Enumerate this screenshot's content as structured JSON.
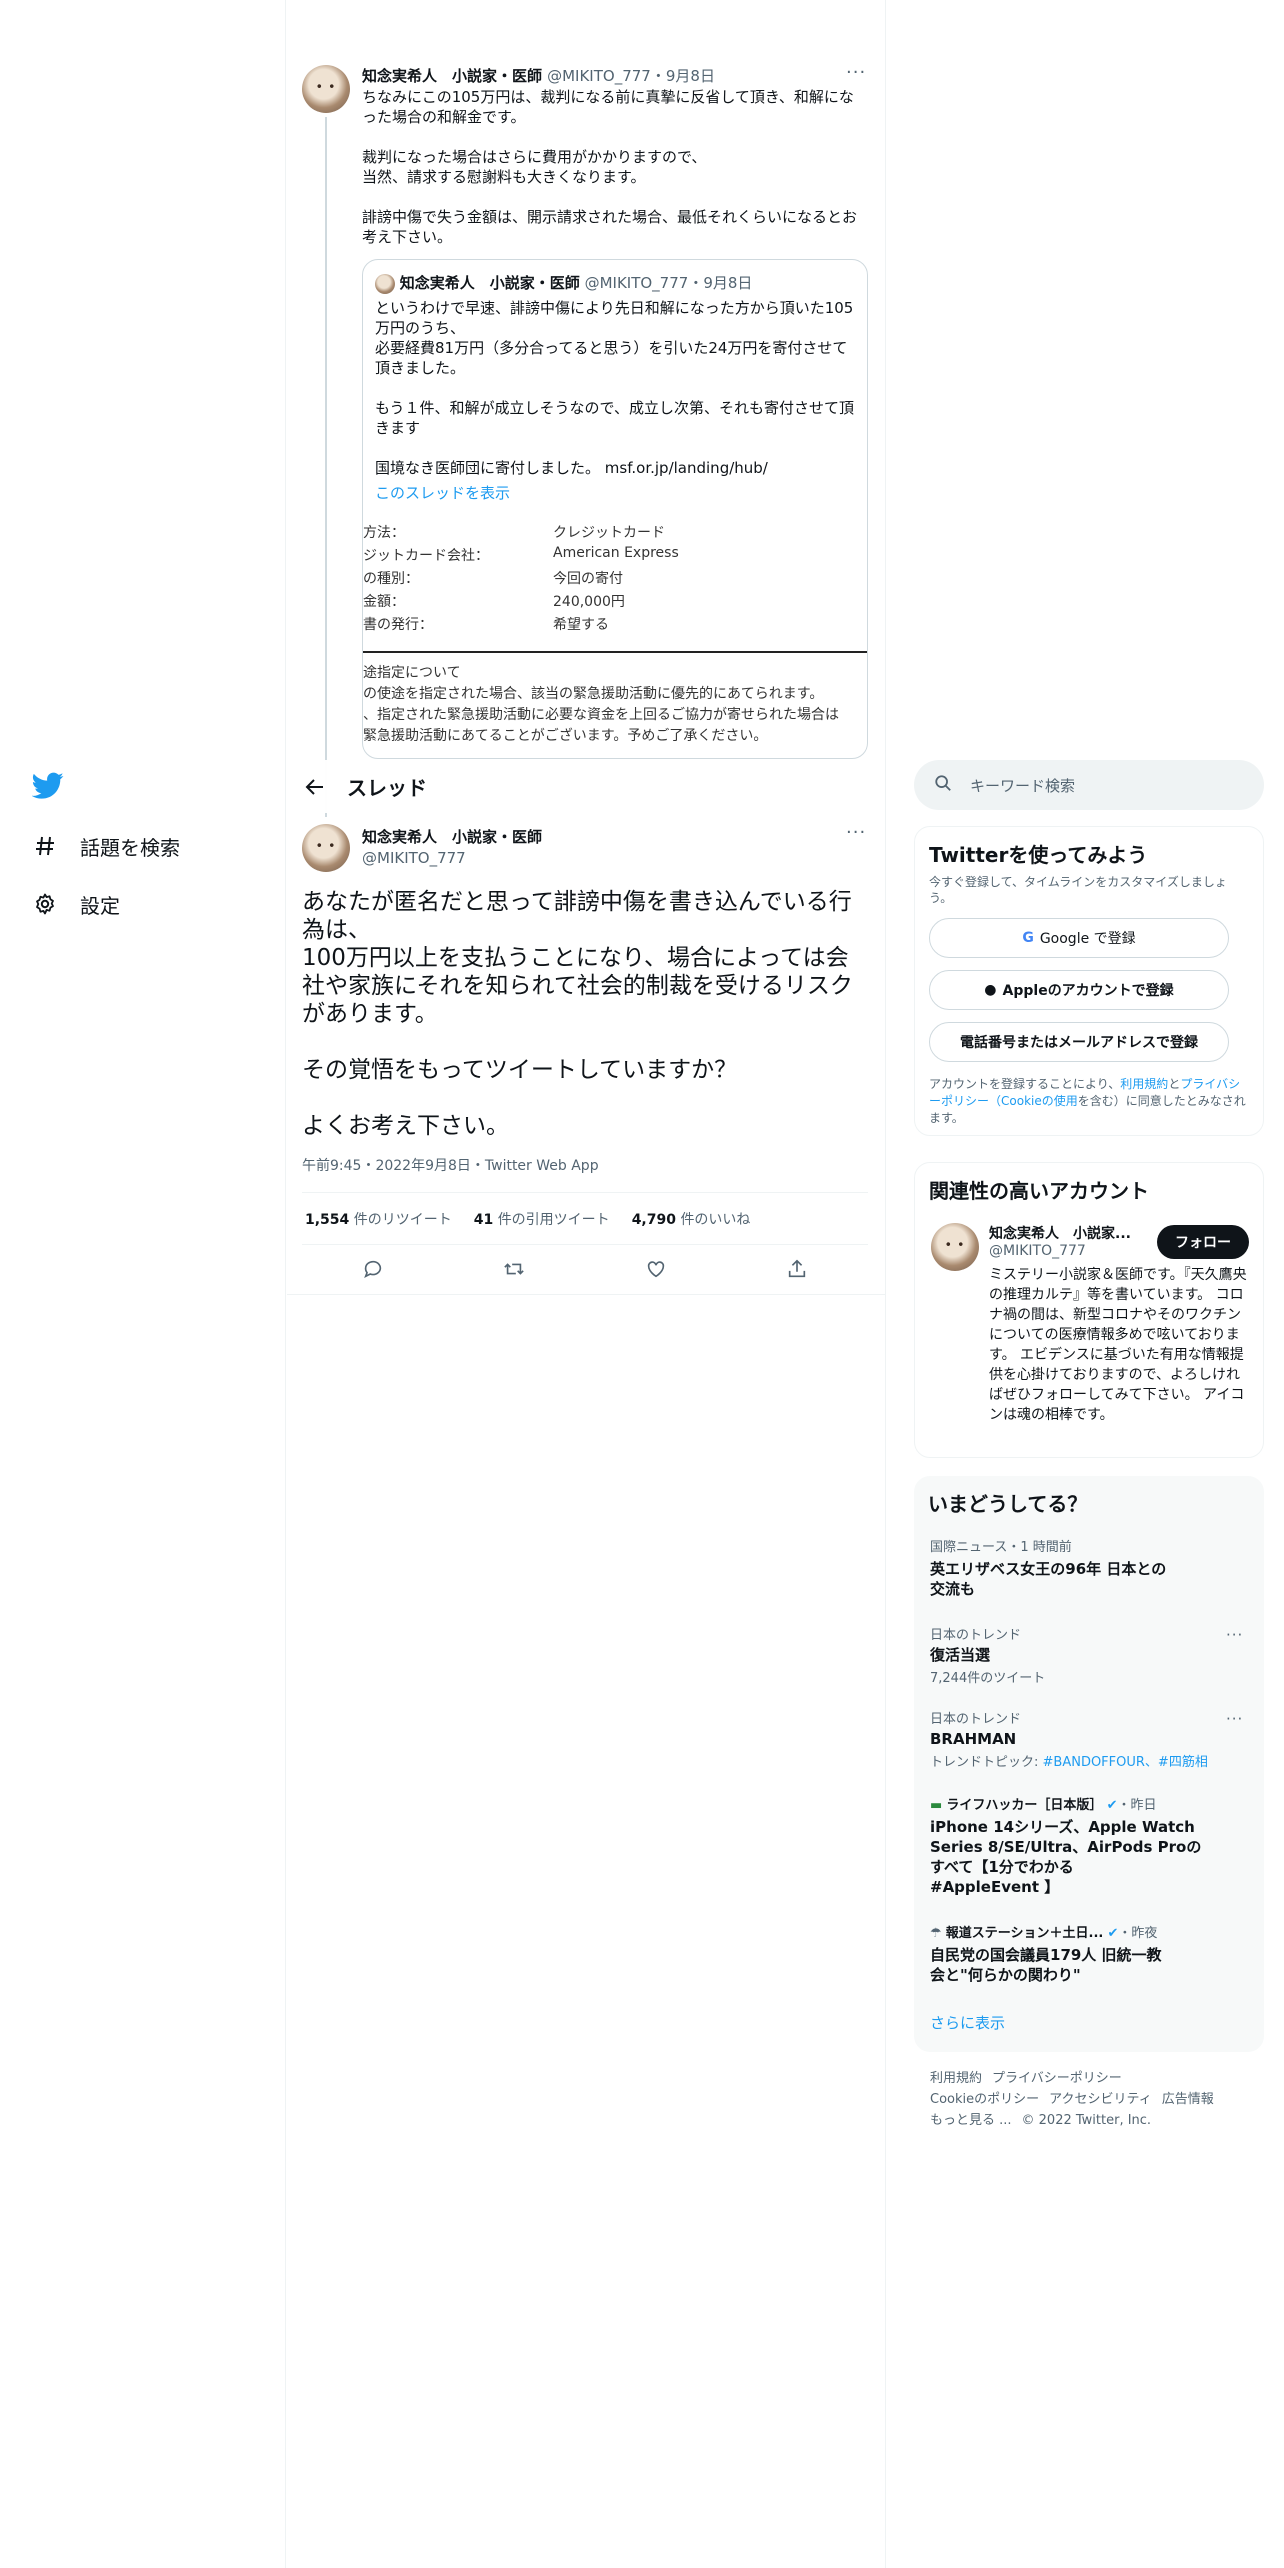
{
  "nav": {
    "items": [
      {
        "label": "話題を検索",
        "icon": "hash-icon"
      },
      {
        "label": "設定",
        "icon": "gear-icon"
      }
    ]
  },
  "thread": {
    "prev_tweet": {
      "name": "知念実希人　小説家・医師",
      "handle": "@MIKITO_777",
      "date": "9月8日",
      "body": "ちなみにこの105万円は、裁判になる前に真摯に反省して頂き、和解になった場合の和解金です。\n\n裁判になった場合はさらに費用がかかりますので、\n当然、請求する慰謝料も大きくなります。\n\n誹謗中傷で失う金額は、開示請求された場合、最低それくらいになるとお考え下さい。",
      "quote": {
        "name": "知念実希人　小説家・医師",
        "handle": "@MIKITO_777",
        "date": "9月8日",
        "body": "というわけで早速、誹謗中傷により先日和解になった方から頂いた105万円のうち、\n必要経費81万円（多分合ってると思う）を引いた24万円を寄付させて頂きました。\n\nもう１件、和解が成立しそうなので、成立し次第、それも寄付させて頂きます\n\n国境なき医師団に寄付しました。 msf.or.jp/landing/hub/",
        "show_thread": "このスレッドを表示",
        "receipt": [
          {
            "k": "方法：",
            "v": "クレジットカード"
          },
          {
            "k": "ジットカード会社：",
            "v": "American Express"
          },
          {
            "k": "の種別：",
            "v": "今回の寄付"
          },
          {
            "k": "金額：",
            "v": "240,000円"
          },
          {
            "k": "書の発行：",
            "v": "希望する"
          }
        ],
        "note": "途指定について\nの使途を指定された場合、該当の緊急援助活動に優先的にあてられます。\n、指定された緊急援助活動に必要な資金を上回るご協力が寄せられた場合は\n緊急援助活動にあてることがございます。予めご了承ください。"
      }
    },
    "header_title": "スレッド",
    "main_tweet": {
      "name": "知念実希人　小説家・医師",
      "handle": "@MIKITO_777",
      "body": "あなたが匿名だと思って誹謗中傷を書き込んでいる行為は、\n100万円以上を支払うことになり、場合によっては会社や家族にそれを知られて社会的制裁を受けるリスクがあります。\n\nその覚悟をもってツイートしていますか？\n\nよくお考え下さい。",
      "timestamp": "午前9:45・2022年9月8日・Twitter Web App",
      "stats": [
        {
          "count": "1,554",
          "label": "件のリツイート"
        },
        {
          "count": "41",
          "label": "件の引用ツイート"
        },
        {
          "count": "4,790",
          "label": "件のいいね"
        }
      ]
    }
  },
  "right": {
    "search_placeholder": "キーワード検索",
    "signup": {
      "title": "Twitterを使ってみよう",
      "subtitle": "今すぐ登録して、タイムラインをカスタマイズしましょう。",
      "google": "Google で登録",
      "apple": "Appleのアカウントで登録",
      "phone": "電話番号またはメールアドレスで登録",
      "legal_pre": "アカウントを登録することにより、",
      "legal_terms": "利用規約",
      "legal_and": "と",
      "legal_privacy": "プライバシーポリシー（Cookieの使用",
      "legal_post": "を含む）に同意したとみなされます。"
    },
    "related": {
      "title": "関連性の高いアカウント",
      "name": "知念実希人　小説家...",
      "handle": "@MIKITO_777",
      "follow": "フォロー",
      "bio": "ミステリー小説家＆医師です。『天久鷹央の推理カルテ』等を書いています。 コロナ禍の間は、新型コロナやそのワクチンについての医療情報多めで呟いております。 エビデンスに基づいた有用な情報提供を心掛けておりますので、よろしければぜひフォローしてみて下さい。 アイコンは魂の相棒です。"
    },
    "trends": {
      "title": "いまどうしてる？",
      "items": [
        {
          "ctx": "国際ニュース・1 時間前",
          "title": "英エリザベス女王の96年 日本との\n交流も"
        },
        {
          "ctx": "日本のトレンド",
          "title": "復活当選",
          "sub": "7,244件のツイート"
        },
        {
          "ctx": "日本のトレンド",
          "title": "BRAHMAN",
          "sub_pre": "トレンドトピック: ",
          "sub_links": "#BANDOFFOUR、#四筋相"
        },
        {
          "ctx_source": "ライフハッカー［日本版］",
          "ctx_time": "・昨日",
          "title": "iPhone 14シリーズ、Apple Watch\nSeries 8/SE/Ultra、AirPods Proの\nすべて【1分でわかる\n#AppleEvent 】"
        },
        {
          "ctx_source": "報道ステーション＋土日...",
          "ctx_time": "・昨夜",
          "title": "自民党の国会議員179人 旧統一教\n会と\"何らかの関わり\""
        }
      ],
      "more": "さらに表示"
    },
    "footer": {
      "line1": [
        "利用規約",
        "プライバシーポリシー"
      ],
      "line2": [
        "Cookieのポリシー",
        "アクセシビリティ",
        "広告情報"
      ],
      "line3": [
        "もっと見る ...",
        "© 2022 Twitter, Inc."
      ]
    }
  },
  "colors": {
    "accent": "#1d9bf0",
    "text": "#0f1419",
    "muted": "#536471"
  }
}
